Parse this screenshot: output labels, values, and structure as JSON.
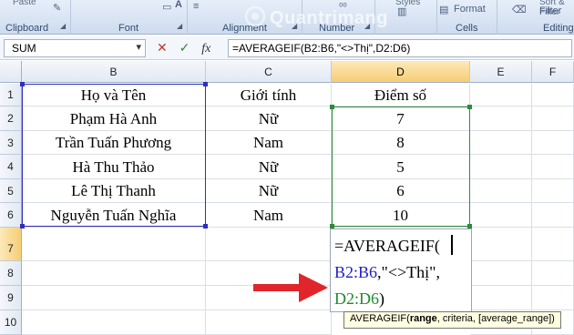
{
  "ribbon": {
    "top_items": [
      "Paste",
      "Styles"
    ],
    "groups": [
      {
        "key": "clipboard",
        "title": "Clipboard"
      },
      {
        "key": "font",
        "title": "Font"
      },
      {
        "key": "alignment",
        "title": "Alignment"
      },
      {
        "key": "number",
        "title": "Number"
      },
      {
        "key": "cells",
        "title": "Cells"
      },
      {
        "key": "editing",
        "title": "Editing"
      }
    ],
    "format_label": "Format",
    "sort_filter_label": "Sort & Filter",
    "filter_label": "Filter"
  },
  "formula_bar": {
    "name_box": "SUM",
    "cancel_icon": "✕",
    "enter_icon": "✓",
    "fx_label": "fx",
    "formula": "=AVERAGEIF(B2:B6,\"<>Thị\",D2:D6)"
  },
  "columns": [
    "B",
    "C",
    "D",
    "E",
    "F"
  ],
  "rows": [
    "1",
    "2",
    "3",
    "4",
    "5",
    "6",
    "7",
    "8",
    "9",
    "10"
  ],
  "table": {
    "headers": [
      "Họ và Tên",
      "Giới tính",
      "Điểm số"
    ],
    "records": [
      {
        "name": "Phạm Hà Anh",
        "gender": "Nữ",
        "score": "7"
      },
      {
        "name": "Trần Tuấn Phương",
        "gender": "Nam",
        "score": "8"
      },
      {
        "name": "Hà Thu Thảo",
        "gender": "Nữ",
        "score": "5"
      },
      {
        "name": "Lê Thị Thanh",
        "gender": "Nữ",
        "score": "6"
      },
      {
        "name": "Nguyễn Tuấn Nghĩa",
        "gender": "Nam",
        "score": "10"
      }
    ]
  },
  "editing_cell": {
    "line1": "=AVERAGEIF(",
    "line2_range": "B2:B6",
    "line2_rest": ",\"<>Thị\",",
    "line3_range": "D2:D6",
    "line3_rest": ")"
  },
  "tooltip": {
    "fn": "AVERAGEIF(",
    "arg1": "range",
    "rest": ", criteria, [average_range])"
  },
  "watermark": "Quantrimang",
  "colors": {
    "range_b": "#2f2fbf",
    "range_d": "#2e8b3a",
    "arrow": "#e0262a"
  }
}
